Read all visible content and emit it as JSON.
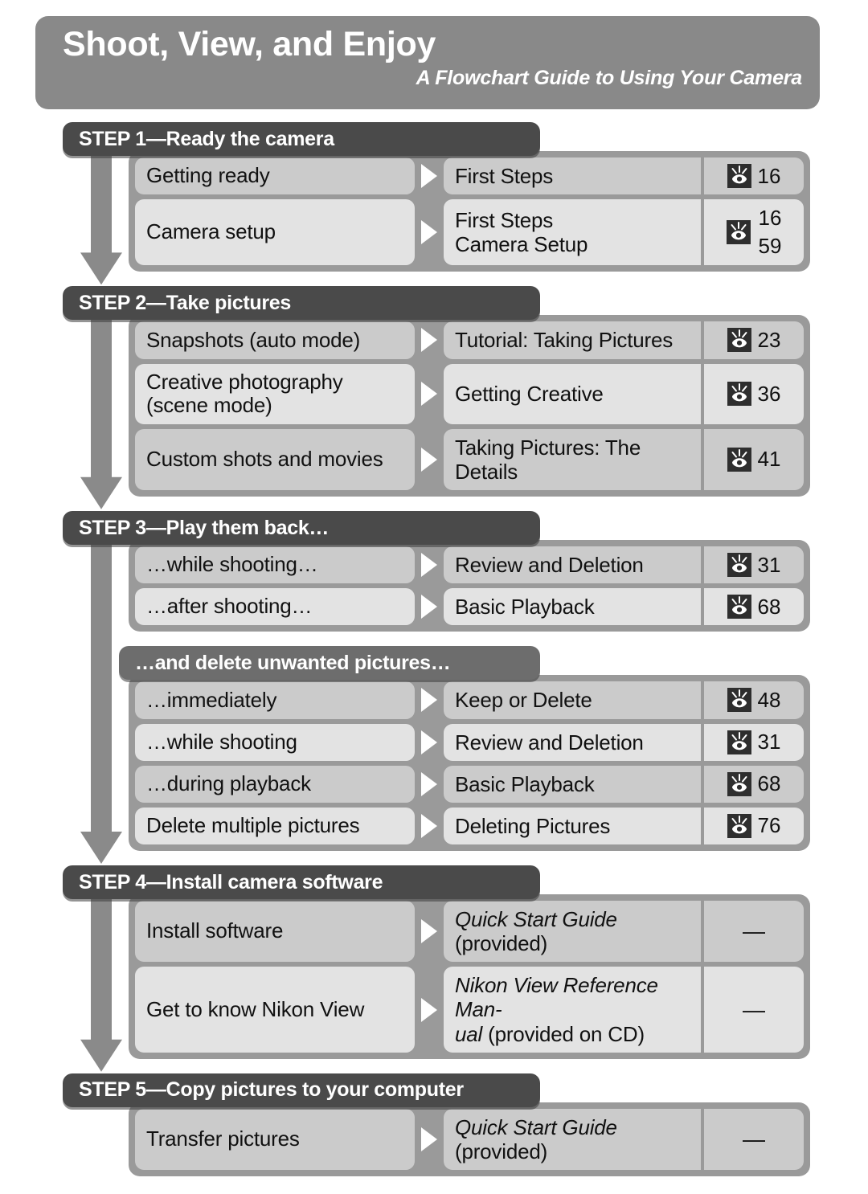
{
  "header": {
    "title": "Shoot, View, and Enjoy",
    "subtitle": "A Flowchart Guide to Using Your Camera"
  },
  "icons": {
    "page_reference": "eye-icon",
    "flow_arrow": "triangle-right-icon",
    "step_connector": "down-arrow-icon"
  },
  "colors": {
    "header_band": "#898989",
    "step_banner": "#4a4a4a",
    "sub_banner": "#6d6d6d",
    "group_background": "#9a9a9a",
    "row_shade_dark": "#cbcbcb",
    "row_shade_light": "#e3e3e3",
    "text": "#111111",
    "banner_text": "#ffffff"
  },
  "sections": [
    {
      "banner": "STEP 1—Ready the camera",
      "banner_type": "step",
      "rows": [
        {
          "action": "Getting ready",
          "reference": "First Steps",
          "reference_italic": false,
          "pages": [
            "16"
          ],
          "has_icon": true,
          "shade": "a"
        },
        {
          "action": "Camera setup",
          "reference": "First Steps\nCamera Setup",
          "reference_italic": false,
          "pages": [
            "16",
            "59"
          ],
          "has_icon": true,
          "shade": "b"
        }
      ]
    },
    {
      "banner": "STEP 2—Take pictures",
      "banner_type": "step",
      "rows": [
        {
          "action": "Snapshots (auto mode)",
          "reference": "Tutorial: Taking Pictures",
          "reference_italic": false,
          "pages": [
            "23"
          ],
          "has_icon": true,
          "shade": "a"
        },
        {
          "action": "Creative photography\n(scene mode)",
          "reference": "Getting Creative",
          "reference_italic": false,
          "pages": [
            "36"
          ],
          "has_icon": true,
          "shade": "b"
        },
        {
          "action": "Custom shots and movies",
          "reference": "Taking Pictures: The Details",
          "reference_italic": false,
          "pages": [
            "41"
          ],
          "has_icon": true,
          "shade": "a"
        }
      ]
    },
    {
      "banner": "STEP 3—Play them back…",
      "banner_type": "step",
      "rows": [
        {
          "action": "…while shooting…",
          "reference": "Review and Deletion",
          "reference_italic": false,
          "pages": [
            "31"
          ],
          "has_icon": true,
          "shade": "a"
        },
        {
          "action": "…after shooting…",
          "reference": "Basic Playback",
          "reference_italic": false,
          "pages": [
            "68"
          ],
          "has_icon": true,
          "shade": "b"
        }
      ]
    },
    {
      "banner": "…and delete unwanted pictures…",
      "banner_type": "sub",
      "rows": [
        {
          "action": "…immediately",
          "reference": "Keep or Delete",
          "reference_italic": false,
          "pages": [
            "48"
          ],
          "has_icon": true,
          "shade": "a"
        },
        {
          "action": "…while shooting",
          "reference": "Review and Deletion",
          "reference_italic": false,
          "pages": [
            "31"
          ],
          "has_icon": true,
          "shade": "b"
        },
        {
          "action": "…during playback",
          "reference": "Basic Playback",
          "reference_italic": false,
          "pages": [
            "68"
          ],
          "has_icon": true,
          "shade": "a"
        },
        {
          "action": "Delete multiple pictures",
          "reference": "Deleting Pictures",
          "reference_italic": false,
          "pages": [
            "76"
          ],
          "has_icon": true,
          "shade": "b"
        }
      ]
    },
    {
      "banner": "STEP 4—Install camera software",
      "banner_type": "step",
      "rows": [
        {
          "action": "Install software",
          "reference_italic_part": "Quick Start Guide",
          "reference_roman_part": " (provided)",
          "reference_italic": true,
          "pages": [
            "—"
          ],
          "has_icon": false,
          "shade": "a"
        },
        {
          "action": "Get to know Nikon View",
          "reference_italic_part": "Nikon View Reference Man-\nual",
          "reference_roman_part": " (provided on CD)",
          "reference_italic": true,
          "pages": [
            "—"
          ],
          "has_icon": false,
          "shade": "b"
        }
      ]
    },
    {
      "banner": "STEP 5—Copy pictures to your computer",
      "banner_type": "step",
      "rows": [
        {
          "action": "Transfer pictures",
          "reference_italic_part": "Quick Start Guide",
          "reference_roman_part": " (provided)",
          "reference_italic": true,
          "pages": [
            "—"
          ],
          "has_icon": false,
          "shade": "a"
        }
      ]
    }
  ]
}
